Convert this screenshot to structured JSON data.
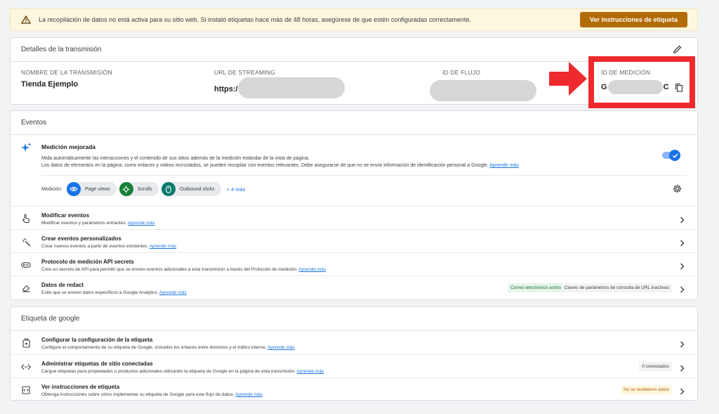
{
  "banner": {
    "text": "La recopilación de datos no está activa para su sitio web. Si instaló etiquetas hace más de 48 horas, asegúrese de que estén configuradas correctamente.",
    "button_label": "Ver instrucciones de etiqueta",
    "icon": "warning-icon"
  },
  "details": {
    "title": "Detalles de la transmisión",
    "stream_name_label": "NOMBRE DE LA TRANSMISIÓN",
    "stream_name_value": "Tienda Ejemplo",
    "url_label": "URL DE STREAMING",
    "url_value": "https:/",
    "flow_id_label": "ID DE FLUJO",
    "measurement_id_label": "ID DE MEDICIÓN",
    "measurement_id_start": "G",
    "measurement_id_end": "C"
  },
  "events": {
    "title": "Eventos",
    "enhanced": {
      "title": "Medición mejorada",
      "desc1": "Mida automáticamente las interacciones y el contenido de sus sitios además de la medición estándar de la vista de página.",
      "desc2": "Los datos de elementos en la página, como enlaces y videos incrustados, se pueden recopilar con eventos relevantes. Debe asegurarse de que no se envíe información de identificación personal a Google.",
      "link": "Aprende más",
      "measure_label": "Medición:",
      "chips": [
        "Page views",
        "Scrolls",
        "Outbound clicks"
      ],
      "more": "+ 4 más"
    },
    "rows": [
      {
        "title": "Modificar eventos",
        "desc": "Modificar eventos y parámetros entrantes.",
        "link": "Aprende más"
      },
      {
        "title": "Crear eventos personalizados",
        "desc": "Crear nuevos eventos a partir de eventos existentes.",
        "link": "Aprende más"
      },
      {
        "title": "Protocolo de medición API secrets",
        "desc": "Cree un secreto de API para permitir que se envíen eventos adicionales a esta transmisión a través del Protocolo de medición.",
        "link": "Aprende más"
      },
      {
        "title": "Datos de redact",
        "desc": "Evite que se envíen datos específicos a Google Analytics.",
        "link": "Aprende más",
        "tag1": "Correo electrónico activo",
        "tag2": "Claves de parámetros de consulta de URL inactivas"
      }
    ]
  },
  "tag_section": {
    "title": "Etiqueta de google",
    "rows": [
      {
        "title": "Configurar la configuración de la etiqueta",
        "desc": "Configure el comportamiento de su etiqueta de Google, incluidos los enlaces entre dominios y el tráfico interno.",
        "link": "Aprende más"
      },
      {
        "title": "Administrar etiquetas de sitio conectadas",
        "desc": "Cargue etiquetas para propiedades o productos adicionales utilizando la etiqueta de Google en la página de esta transmisión.",
        "link": "Aprende más",
        "tag": "0 conectados"
      },
      {
        "title": "Ver instrucciones de etiqueta",
        "desc": "Obtenga instrucciones sobre cómo implementar su etiqueta de Google para este flujo de datos.",
        "link": "Aprende más",
        "tag": "No se recibieron datos"
      }
    ]
  },
  "colors": {
    "accent": "#1a73e8",
    "banner_button": "#b36b06",
    "highlight": "#ee2a2f"
  }
}
